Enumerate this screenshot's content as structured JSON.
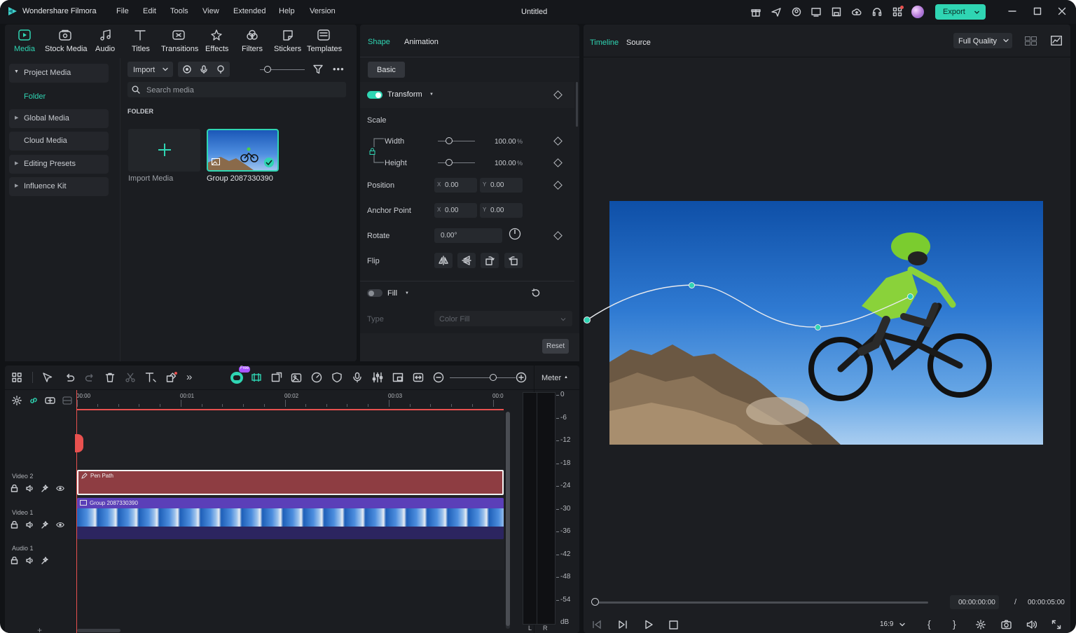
{
  "app": {
    "name": "Wondershare Filmora",
    "title": "Untitled"
  },
  "menu": [
    "File",
    "Edit",
    "Tools",
    "View",
    "Extended",
    "Help",
    "Version"
  ],
  "export_label": "Export",
  "toolbar_tabs": [
    {
      "label": "Media",
      "icon": "media-icon",
      "active": true
    },
    {
      "label": "Stock Media",
      "icon": "stock-media-icon"
    },
    {
      "label": "Audio",
      "icon": "audio-icon"
    },
    {
      "label": "Titles",
      "icon": "titles-icon"
    },
    {
      "label": "Transitions",
      "icon": "transitions-icon"
    },
    {
      "label": "Effects",
      "icon": "effects-icon"
    },
    {
      "label": "Filters",
      "icon": "filters-icon"
    },
    {
      "label": "Stickers",
      "icon": "stickers-icon"
    },
    {
      "label": "Templates",
      "icon": "templates-icon"
    }
  ],
  "media_sidebar": {
    "project_media": "Project Media",
    "folder": "Folder",
    "global_media": "Global Media",
    "cloud_media": "Cloud Media",
    "editing_presets": "Editing Presets",
    "influence_kit": "Influence Kit"
  },
  "media": {
    "import_label": "Import",
    "search_placeholder": "Search media",
    "folder_header": "FOLDER",
    "import_media_label": "Import Media",
    "clip_name": "Group 2087330390"
  },
  "properties": {
    "tabs": [
      "Shape",
      "Animation"
    ],
    "subtab": "Basic",
    "transform_label": "Transform",
    "scale_label": "Scale",
    "width_label": "Width",
    "width_value": "100.00",
    "height_label": "Height",
    "height_value": "100.00",
    "percent": "%",
    "position_label": "Position",
    "x_label": "X",
    "y_label": "Y",
    "pos_x": "0.00",
    "pos_y": "0.00",
    "anchor_label": "Anchor Point",
    "anchor_x": "0.00",
    "anchor_y": "0.00",
    "rotate_label": "Rotate",
    "rotate_value": "0.00°",
    "flip_label": "Flip",
    "fill_label": "Fill",
    "type_label": "Type",
    "type_value": "Color Fill",
    "reset_label": "Reset"
  },
  "preview": {
    "tabs": [
      "Timeline",
      "Source"
    ],
    "quality": "Full Quality",
    "current_time": "00:00:00:00",
    "separator": "/",
    "total_time": "00:00:05:00",
    "aspect": "16:9"
  },
  "timeline": {
    "meter_label": "Meter",
    "free_badge": "Free",
    "ruler": [
      "00:00",
      "00:01",
      "00:02",
      "00:03",
      "00:0"
    ],
    "tracks": [
      {
        "name": "Video 2",
        "clip": "Pen Path"
      },
      {
        "name": "Video 1",
        "clip": "Group 2087330390"
      },
      {
        "name": "Audio 1"
      }
    ],
    "meter_scale": [
      "0",
      "-6",
      "-12",
      "-18",
      "-24",
      "-30",
      "-36",
      "-42",
      "-48",
      "-54",
      "dB"
    ],
    "meter_channels": [
      "L",
      "R"
    ]
  },
  "colors": {
    "accent": "#2fd5b3",
    "pen_clip": "#8e3d42",
    "video_clip": "#5b3fb8",
    "playhead": "#e8514f"
  }
}
